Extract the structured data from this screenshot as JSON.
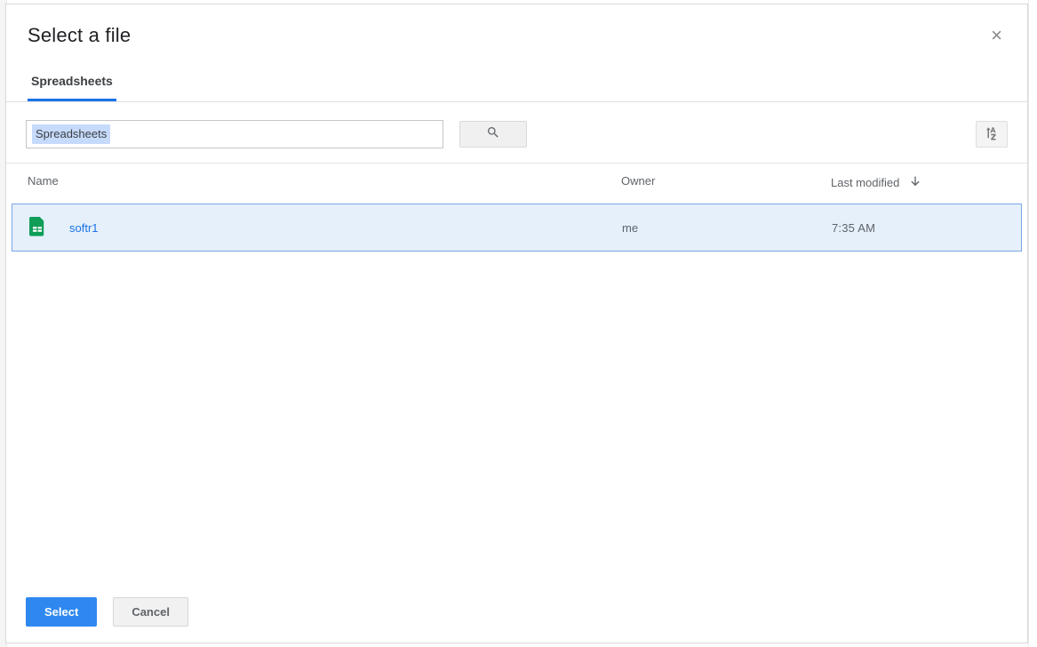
{
  "dialog": {
    "title": "Select a file",
    "close_glyph": "×"
  },
  "tabs": [
    {
      "label": "Spreadsheets"
    }
  ],
  "search": {
    "chip": "Spreadsheets"
  },
  "columns": {
    "name": "Name",
    "owner": "Owner",
    "modified": "Last modified"
  },
  "files": [
    {
      "name": "softr1",
      "owner": "me",
      "modified": "7:35 AM",
      "kind": "sheets",
      "selected": true
    }
  ],
  "footer": {
    "select": "Select",
    "cancel": "Cancel"
  }
}
